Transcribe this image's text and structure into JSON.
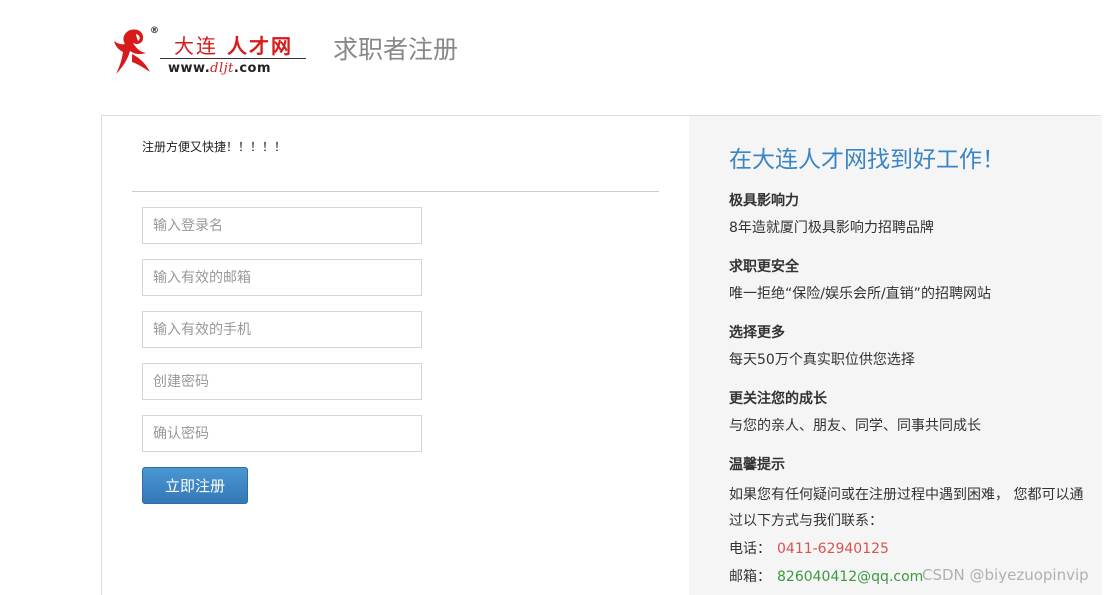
{
  "header": {
    "logo": {
      "cn_thin": "大连",
      "cn_bold": "人才网",
      "url_prefix": "www.",
      "url_mid": "dljt",
      "url_suffix": ".com",
      "reg_mark": "®"
    },
    "page_title": "求职者注册"
  },
  "form": {
    "intro": "注册方便又快捷！！！！！",
    "fields": [
      {
        "name": "username",
        "placeholder": "输入登录名"
      },
      {
        "name": "email",
        "placeholder": "输入有效的邮箱"
      },
      {
        "name": "phone",
        "placeholder": "输入有效的手机"
      },
      {
        "name": "password",
        "placeholder": "创建密码"
      },
      {
        "name": "confirm",
        "placeholder": "确认密码"
      }
    ],
    "submit_label": "立即注册"
  },
  "side": {
    "title": "在大连人才网找到好工作！",
    "features": [
      {
        "heading": "极具影响力",
        "desc": "8年造就厦门极具影响力招聘品牌"
      },
      {
        "heading": "求职更安全",
        "desc": "唯一拒绝“保险/娱乐会所/直销”的招聘网站"
      },
      {
        "heading": "选择更多",
        "desc": "每天50万个真实职位供您选择"
      },
      {
        "heading": "更关注您的成长",
        "desc": "与您的亲人、朋友、同学、同事共同成长"
      },
      {
        "heading": "温馨提示",
        "desc": ""
      }
    ],
    "tip_body": "如果您有任何疑问或在注册过程中遇到困难， 您都可以通过以下方式与我们联系：",
    "phone_label": "电话：",
    "phone_value": "0411-62940125",
    "mail_label": "邮箱：",
    "mail_value": "826040412@qq.com"
  },
  "watermark": "CSDN @biyezuopinvip",
  "colors": {
    "brand_red": "#d71a1a",
    "link_blue": "#3a85c6",
    "button_blue": "#3478b6",
    "phone_red": "#d9534f",
    "mail_green": "#3c9a3c"
  }
}
